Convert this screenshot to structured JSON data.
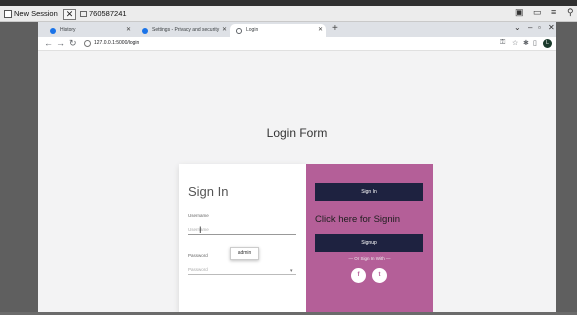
{
  "session": {
    "name": "New Session",
    "close_glyph": "✕",
    "id": "760587241"
  },
  "browser": {
    "tabs": [
      {
        "label": "History",
        "icon": "history-icon",
        "color": "#1a73e8",
        "active": false
      },
      {
        "label": "Settings - Privacy and security",
        "icon": "settings-icon",
        "color": "#1a73e8",
        "active": false
      },
      {
        "label": "Login",
        "icon": "globe-icon",
        "color": "#5f6368",
        "active": true
      }
    ],
    "url": "127.0.0.1:5000/login",
    "profile_initial": "L"
  },
  "page": {
    "title": "Login Form",
    "form": {
      "heading": "Sign In",
      "username_label": "Username",
      "username_placeholder": "Username",
      "password_label": "Password",
      "autofill_value": "admin",
      "password_placeholder": "Password"
    },
    "panel": {
      "signin_button": "Sign In",
      "signin_prompt": "Click here for Signin",
      "signup_button": "Signup",
      "or_text": "— Or Sign In With —",
      "social": [
        {
          "glyph": "f",
          "icon": "facebook-icon"
        },
        {
          "glyph": "t",
          "icon": "twitter-icon"
        }
      ]
    }
  },
  "colors": {
    "accent_panel": "#b45f98",
    "dark_button": "#1e2240"
  }
}
